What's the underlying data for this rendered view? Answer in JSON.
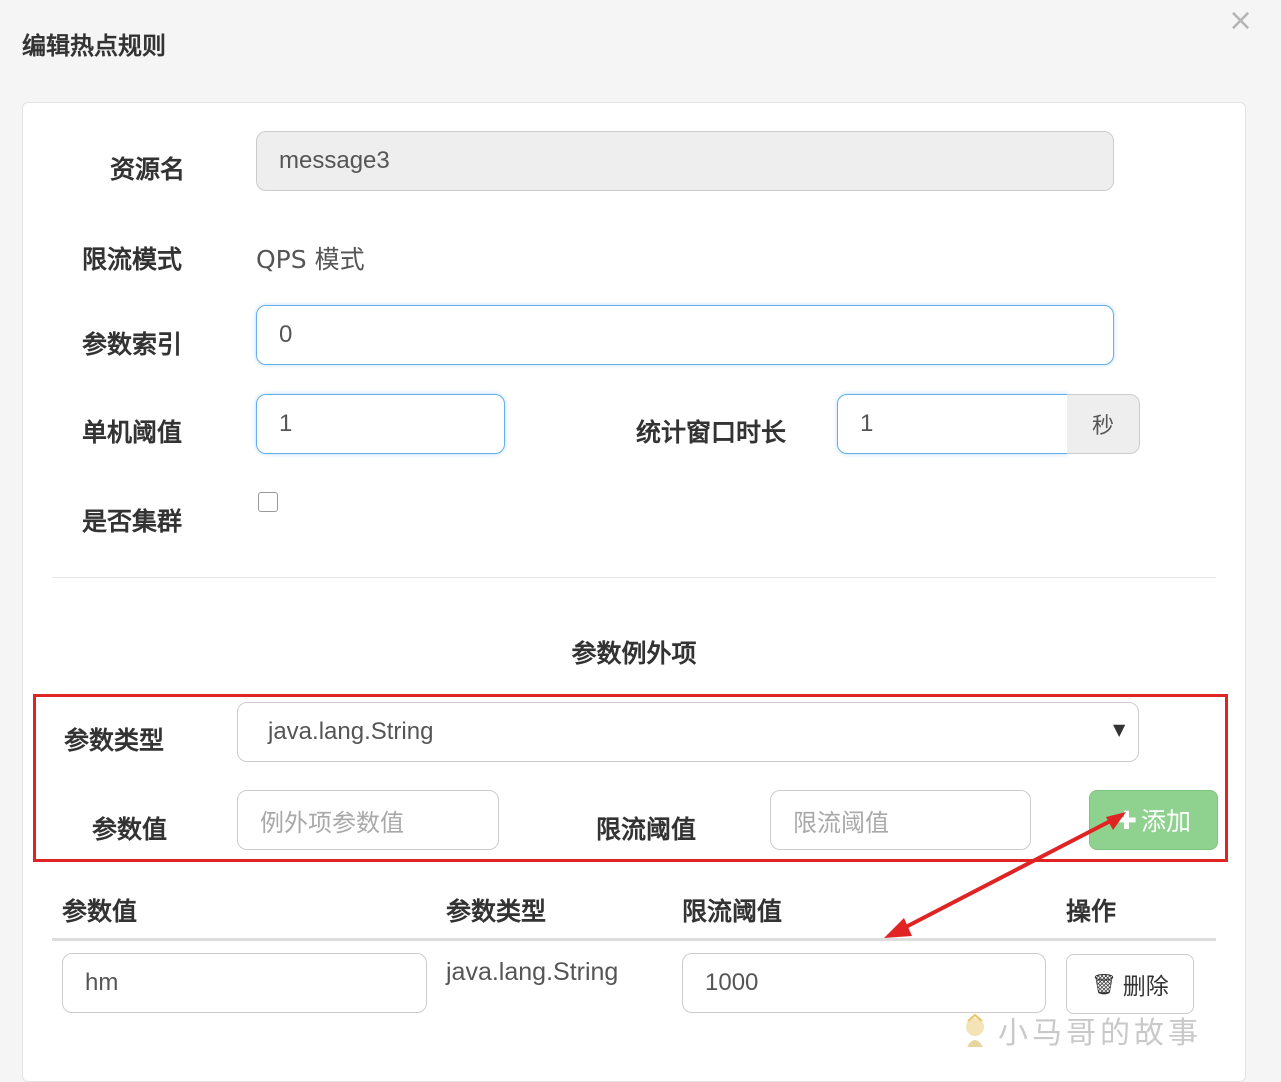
{
  "dialog": {
    "title": "编辑热点规则",
    "close_glyph": "×"
  },
  "form": {
    "resource_label": "资源名",
    "resource_value": "message3",
    "mode_label": "限流模式",
    "mode_value": "QPS 模式",
    "param_index_label": "参数索引",
    "param_index_value": "0",
    "threshold_label": "单机阈值",
    "threshold_value": "1",
    "window_label": "统计窗口时长",
    "window_value": "1",
    "window_unit": "秒",
    "cluster_label": "是否集群",
    "cluster_checked": false
  },
  "exceptions": {
    "section_title": "参数例外项",
    "type_label": "参数类型",
    "type_selected": "java.lang.String",
    "value_label": "参数值",
    "value_placeholder": "例外项参数值",
    "limit_label": "限流阈值",
    "limit_placeholder": "限流阈值",
    "add_button": "添加",
    "highlight_color": "#e02424",
    "add_button_color": "#8fd18f"
  },
  "table": {
    "headers": [
      "参数值",
      "参数类型",
      "限流阈值",
      "操作"
    ],
    "rows": [
      {
        "value": "hm",
        "type": "java.lang.String",
        "limit": "1000",
        "action": "删除"
      }
    ]
  },
  "watermark": "小马哥的故事",
  "icons": {
    "close": "close-icon",
    "caret": "caret-down-icon",
    "plus": "plus-icon",
    "trash": "trash-icon",
    "arrow": "red-arrow-annotation"
  }
}
